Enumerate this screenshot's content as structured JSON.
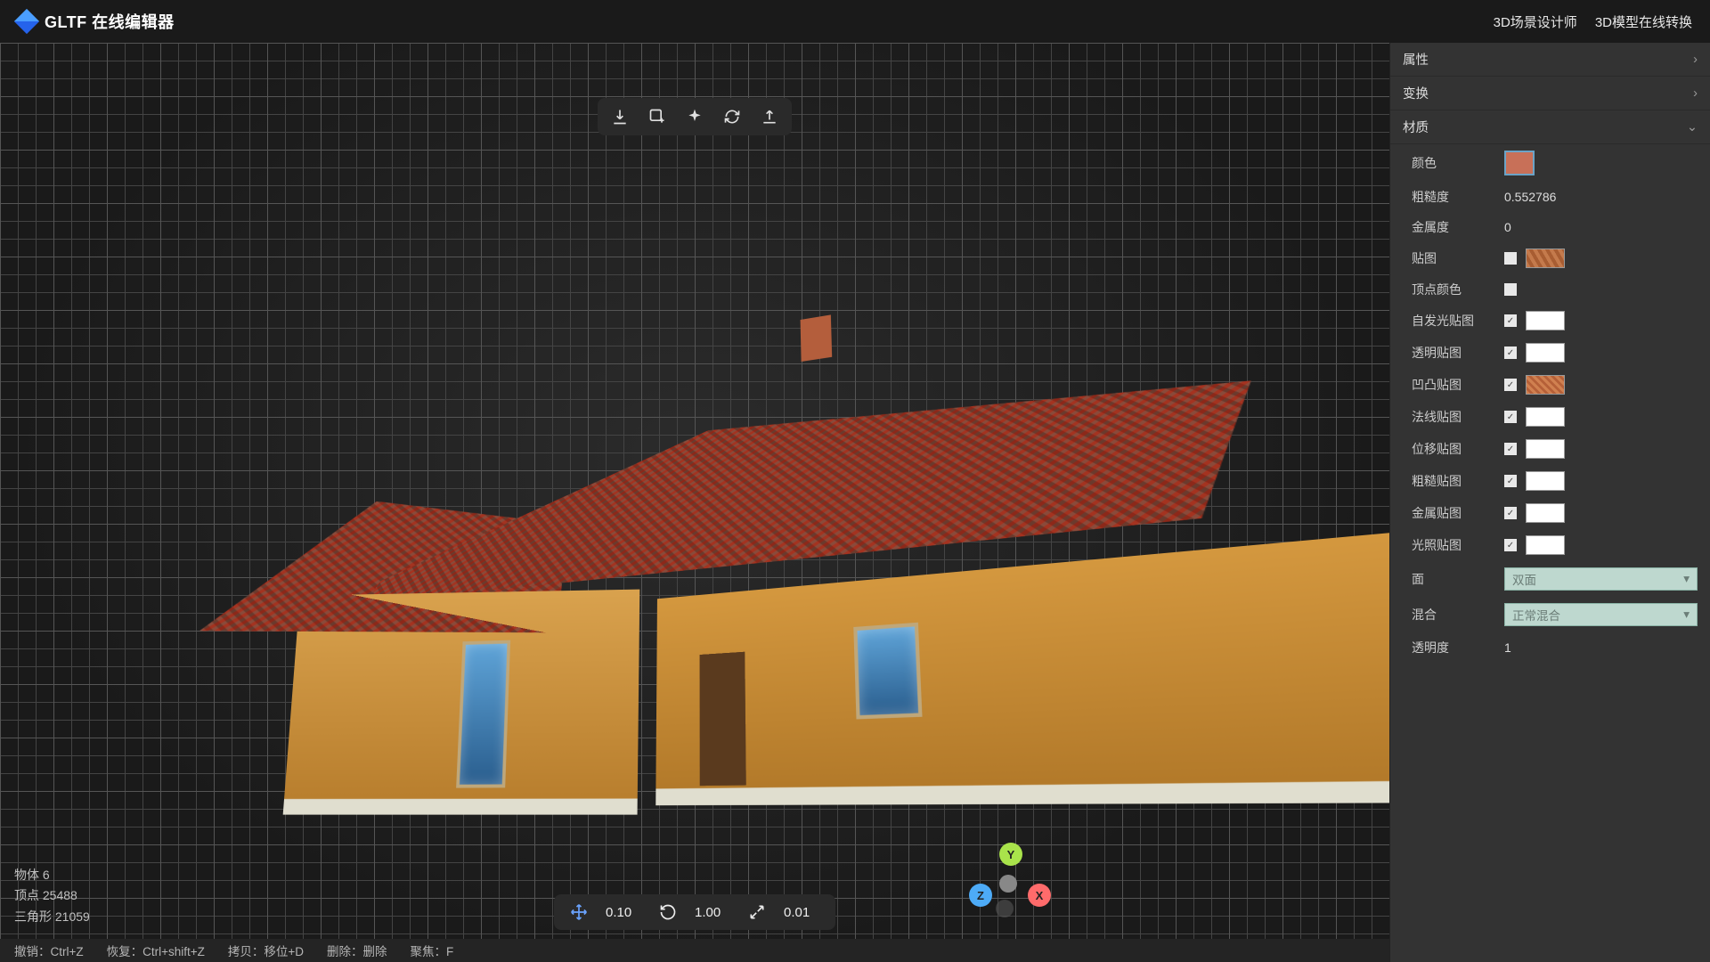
{
  "header": {
    "app_title": "GLTF 在线编辑器",
    "links": {
      "scene_designer": "3D场景设计师",
      "model_converter": "3D模型在线转换"
    }
  },
  "panel": {
    "sections": {
      "attributes": "属性",
      "transform": "变换",
      "material": "材质"
    },
    "material": {
      "color_label": "颜色",
      "color_value": "#c87058",
      "roughness_label": "粗糙度",
      "roughness_value": "0.552786",
      "metalness_label": "金属度",
      "metalness_value": "0",
      "texture_label": "贴图",
      "vertex_color_label": "顶点颜色",
      "emissive_label": "自发光贴图",
      "alpha_label": "透明贴图",
      "bump_label": "凹凸贴图",
      "normal_label": "法线贴图",
      "displacement_label": "位移贴图",
      "roughness_map_label": "粗糙贴图",
      "metalness_map_label": "金属贴图",
      "light_map_label": "光照贴图",
      "side_label": "面",
      "side_value": "双面",
      "blend_label": "混合",
      "blend_value": "正常混合",
      "opacity_label": "透明度",
      "opacity_value": "1"
    }
  },
  "stats": {
    "objects_label": "物体",
    "objects_value": "6",
    "vertices_label": "顶点",
    "vertices_value": "25488",
    "triangles_label": "三角形",
    "triangles_value": "21059"
  },
  "shortcuts": {
    "undo": "撤销：Ctrl+Z",
    "redo": "恢复：Ctrl+shift+Z",
    "copy": "拷贝：移位+D",
    "delete": "删除：删除",
    "focus": "聚焦：F"
  },
  "bottom_toolbar": {
    "move_step": "0.10",
    "rotate_step": "1.00",
    "scale_step": "0.01"
  },
  "gizmo": {
    "y": "Y",
    "x": "X",
    "z": "Z"
  }
}
